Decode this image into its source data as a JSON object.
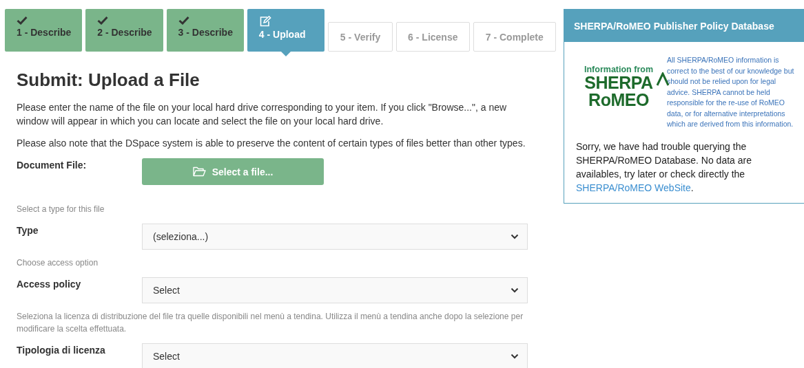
{
  "steps": [
    {
      "label": "1 - Describe",
      "kind": "done"
    },
    {
      "label": "2 - Describe",
      "kind": "done"
    },
    {
      "label": "3 - Describe",
      "kind": "done"
    },
    {
      "label": "4 - Upload",
      "kind": "current"
    },
    {
      "label": "5 - Verify",
      "kind": "todo"
    },
    {
      "label": "6 - License",
      "kind": "todo"
    },
    {
      "label": "7 - Complete",
      "kind": "todo"
    }
  ],
  "title": "Submit: Upload a File",
  "paragraphs": [
    "Please enter the name of the file on your local hard drive corresponding to your item. If you click \"Browse...\", a new window will appear in which you can locate and select the file on your local hard drive.",
    "Please also note that the DSpace system is able to preserve the content of certain types of files better than other types."
  ],
  "form": [
    {
      "kind": "file",
      "label": "Document File:",
      "button": "Select a file..."
    },
    {
      "kind": "hint",
      "text": "Select a type for this file"
    },
    {
      "kind": "select",
      "label": "Type",
      "value": "(seleziona...)"
    },
    {
      "kind": "hint",
      "text": "Choose access option"
    },
    {
      "kind": "select",
      "label": "Access policy",
      "value": "Select"
    },
    {
      "kind": "hint",
      "text": "Seleziona la licenza di distribuzione del file tra quelle disponibili nel menù a tendina. Utilizza il menù a tendina anche dopo la selezione per modificare la scelta effettuata."
    },
    {
      "kind": "select",
      "label": "Tipologia di licenza",
      "value": "Select"
    }
  ],
  "panel": {
    "title": "SHERPA/RoMEO Publisher Policy Database",
    "logo": {
      "caption": "Information from",
      "line_1": "SHERPA",
      "line_2": "RoMEO"
    },
    "disclaimer": "All SHERPA/RoMEO information is correct to the best of our knowledge but should not be relied upon for legal advice. SHERPA cannot be held responsible for the re-use of RoMEO data, or for alternative interpretations which are derived from this information.",
    "message": "Sorry, we have had trouble querying the SHERPA/RoMEO Database. No data are availables, try later or check directly the",
    "link": "SHERPA/RoMEO WebSite",
    "message_end": "."
  }
}
